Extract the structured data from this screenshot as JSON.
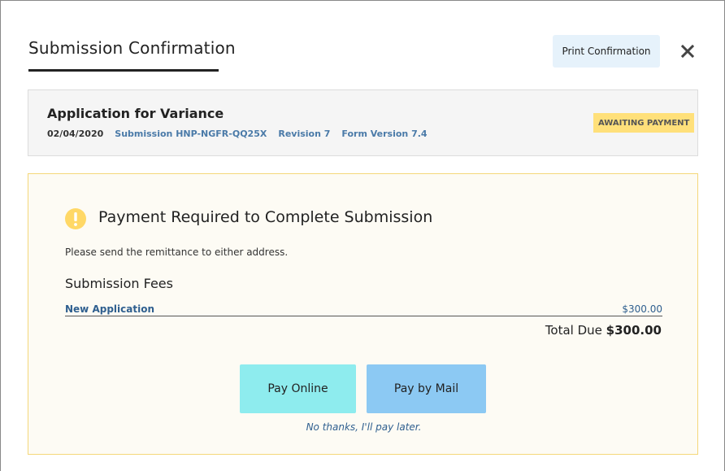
{
  "modal": {
    "title": "Submission Confirmation",
    "print_label": "Print Confirmation",
    "close_icon": "close-icon"
  },
  "application": {
    "title": "Application for Variance",
    "date": "02/04/2020",
    "submission": "Submission HNP-NGFR-QQ25X",
    "revision": "Revision 7",
    "form_version": "Form Version 7.4",
    "status": "AWAITING PAYMENT",
    "status_color": "#ffe07a"
  },
  "payment": {
    "icon": "warning-icon",
    "heading": "Payment Required to Complete Submission",
    "instructions": "Please send the remittance to either address.",
    "fees_heading": "Submission Fees",
    "fees": [
      {
        "name": "New Application",
        "amount": "$300.00"
      }
    ],
    "total_label": "Total Due",
    "total_amount": "$300.00",
    "pay_online_label": "Pay Online",
    "pay_mail_label": "Pay by Mail",
    "later_label": "No thanks, I'll pay later.",
    "pay_online_color": "#8eecee",
    "pay_mail_color": "#8cc9f3"
  }
}
